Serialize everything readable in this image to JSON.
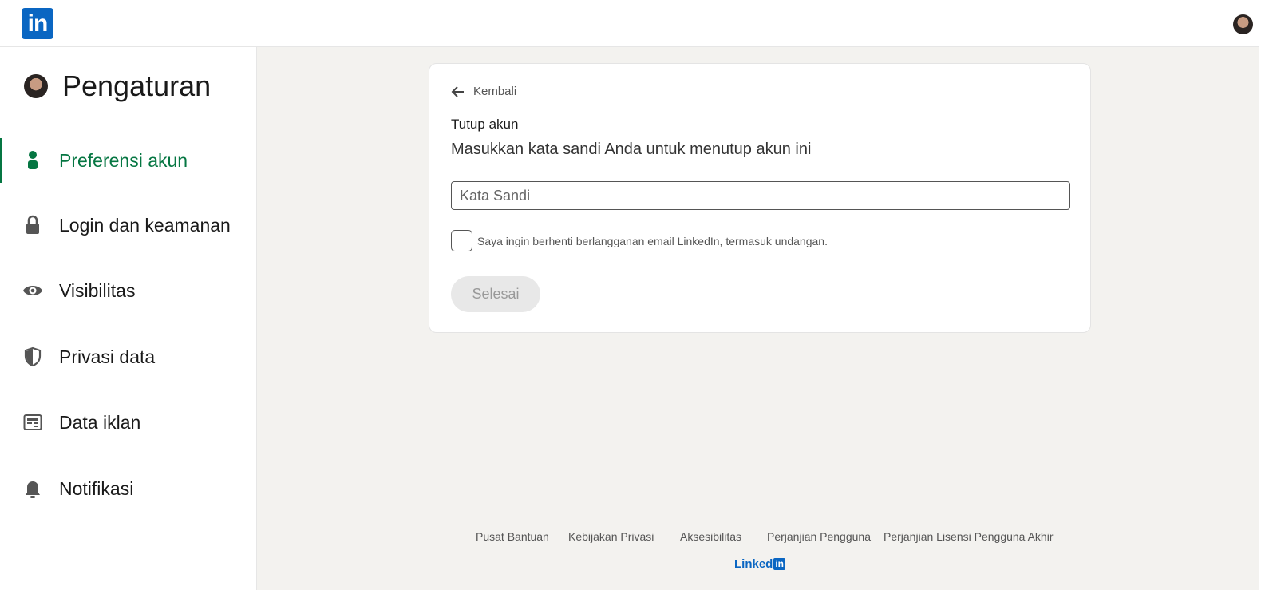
{
  "header": {
    "logo_text": "in"
  },
  "sidebar": {
    "title": "Pengaturan",
    "items": [
      {
        "label": "Preferensi akun",
        "icon": "person-icon",
        "active": true
      },
      {
        "label": "Login dan keamanan",
        "icon": "lock-icon",
        "active": false
      },
      {
        "label": "Visibilitas",
        "icon": "eye-icon",
        "active": false
      },
      {
        "label": "Privasi data",
        "icon": "shield-icon",
        "active": false
      },
      {
        "label": "Data iklan",
        "icon": "ad-data-icon",
        "active": false
      },
      {
        "label": "Notifikasi",
        "icon": "bell-icon",
        "active": false
      }
    ]
  },
  "card": {
    "back_label": "Kembali",
    "heading": "Tutup akun",
    "subheading": "Masukkan kata sandi Anda untuk menutup akun ini",
    "password_placeholder": "Kata Sandi",
    "password_value": "",
    "checkbox_label": "Saya ingin berhenti berlangganan email LinkedIn, termasuk undangan.",
    "checkbox_checked": false,
    "submit_label": "Selesai"
  },
  "footer": {
    "links": [
      "Pusat Bantuan",
      "Kebijakan Privasi",
      "Aksesibilitas",
      "Perjanjian Pengguna",
      "Perjanjian Lisensi Pengguna Akhir"
    ],
    "logo_text": "Linked",
    "logo_badge": "in"
  },
  "colors": {
    "brand": "#0a66c2",
    "active_nav": "#057642",
    "background": "#f3f2ef"
  }
}
